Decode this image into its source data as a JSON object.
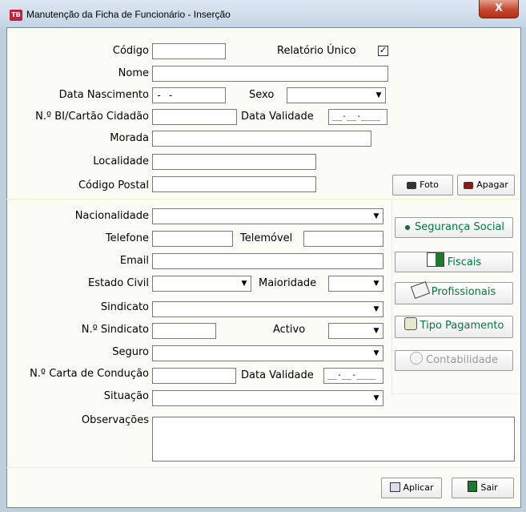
{
  "window": {
    "title": "Manutenção da Ficha de Funcionário - Inserção",
    "app_icon": "TB",
    "close_label": "X"
  },
  "labels": {
    "codigo": "Código",
    "relatorio_unico": "Relatório Único",
    "nome": "Nome",
    "data_nascimento": "Data Nascimento",
    "sexo": "Sexo",
    "bi": "N.º BI/Cartão Cidadão",
    "data_validade": "Data Validade",
    "morada": "Morada",
    "localidade": "Localidade",
    "codigo_postal": "Código Postal",
    "nacionalidade": "Nacionalidade",
    "telefone": "Telefone",
    "telemovel": "Telemóvel",
    "email": "Email",
    "estado_civil": "Estado Civil",
    "maioridade": "Maioridade",
    "sindicato": "Sindicato",
    "n_sindicato": "N.º Sindicato",
    "activo": "Activo",
    "seguro": "Seguro",
    "carta": "N.º Carta de Condução",
    "data_validade2": "Data Validade",
    "situacao": "Situação",
    "observacoes": "Observações"
  },
  "values": {
    "data_nascimento": " - -",
    "data_validade": "__-__-____",
    "data_validade2": "__-__-____",
    "relatorio_unico_check": "✓"
  },
  "buttons": {
    "foto": "Foto",
    "apagar": "Apagar",
    "seguranca_social": "Segurança Social",
    "fiscais": "Fiscais",
    "profissionais": "Profissionais",
    "tipo_pagamento": "Tipo Pagamento",
    "contabilidade": "Contabilidade",
    "aplicar": "Aplicar",
    "sair": "Sair"
  },
  "combo_arrow": "▼"
}
